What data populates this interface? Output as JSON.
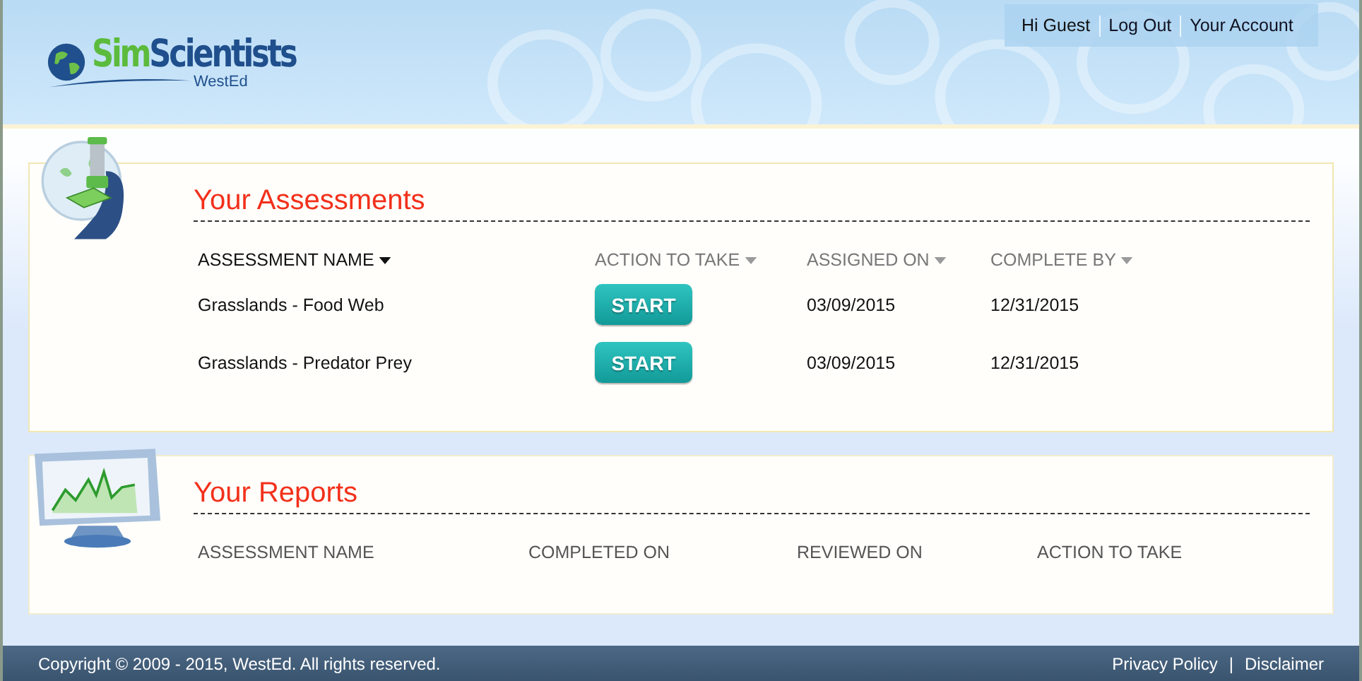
{
  "logo": {
    "prefix": "Sim",
    "name": "Scientists",
    "sub": "WestEd"
  },
  "user_nav": [
    "Hi Guest",
    "Log Out",
    "Your Account"
  ],
  "assessments": {
    "title": "Your Assessments",
    "columns": [
      {
        "label": "ASSESSMENT NAME",
        "sorted": true
      },
      {
        "label": "ACTION TO TAKE",
        "sorted": false
      },
      {
        "label": "ASSIGNED ON",
        "sorted": false
      },
      {
        "label": "COMPLETE BY",
        "sorted": false
      }
    ],
    "rows": [
      {
        "name": "Grasslands - Food Web",
        "action": "START",
        "assigned": "03/09/2015",
        "due": "12/31/2015"
      },
      {
        "name": "Grasslands - Predator Prey",
        "action": "START",
        "assigned": "03/09/2015",
        "due": "12/31/2015"
      }
    ]
  },
  "reports": {
    "title": "Your Reports",
    "columns": [
      "ASSESSMENT NAME",
      "COMPLETED ON",
      "REVIEWED ON",
      "ACTION TO TAKE"
    ]
  },
  "footer": {
    "copyright": "Copyright © 2009 - 2015, WestEd. All rights reserved.",
    "links": [
      "Privacy Policy",
      "Disclaimer"
    ],
    "separator": "|"
  }
}
